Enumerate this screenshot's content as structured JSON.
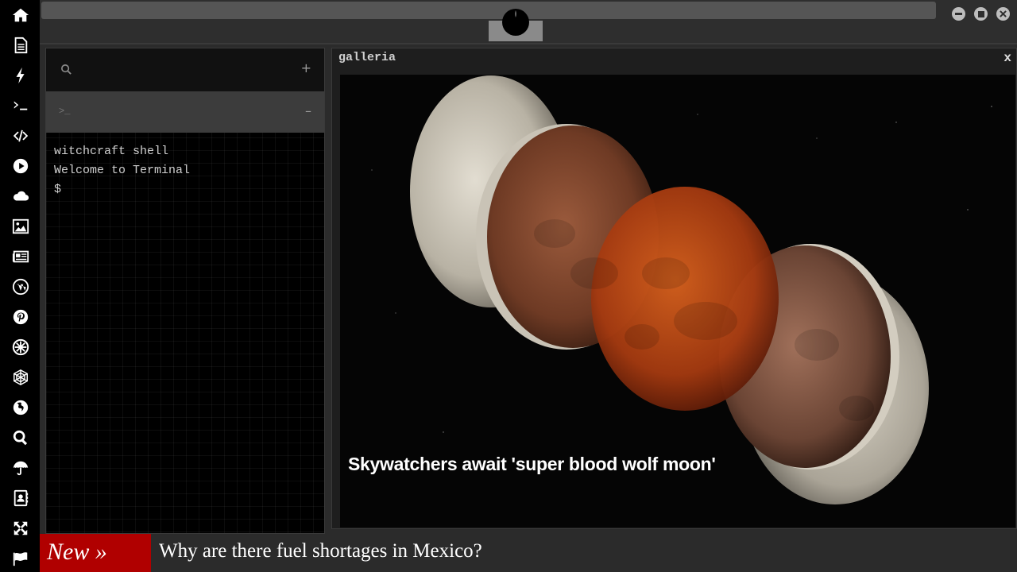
{
  "sidebar": {
    "icons": [
      "home-icon",
      "document-icon",
      "bolt-icon",
      "terminal-icon",
      "code-icon",
      "play-icon",
      "cloud-icon",
      "image-icon",
      "newspaper-icon",
      "wordpress-icon",
      "pinterest-icon",
      "empire-icon",
      "network-icon",
      "globe-icon",
      "search-icon",
      "umbrella-icon",
      "contacts-icon",
      "expand-icon",
      "flag-icon"
    ]
  },
  "terminal": {
    "search_icon": "search-icon",
    "add_label": "+",
    "prompt_label": ">_",
    "minimize_label": "–",
    "lines": [
      "witchcraft shell",
      "Welcome to Terminal",
      "$"
    ]
  },
  "galleria": {
    "title": "galleria",
    "close_label": "x",
    "caption": "Skywatchers await 'super blood wolf moon'"
  },
  "ticker": {
    "badge": "New »",
    "headline": "Why are there fuel shortages in Mexico?"
  },
  "colors": {
    "sidebar_bg": "#000000",
    "badge_red": "#b00000",
    "panel_bg": "#2b2b2b"
  }
}
